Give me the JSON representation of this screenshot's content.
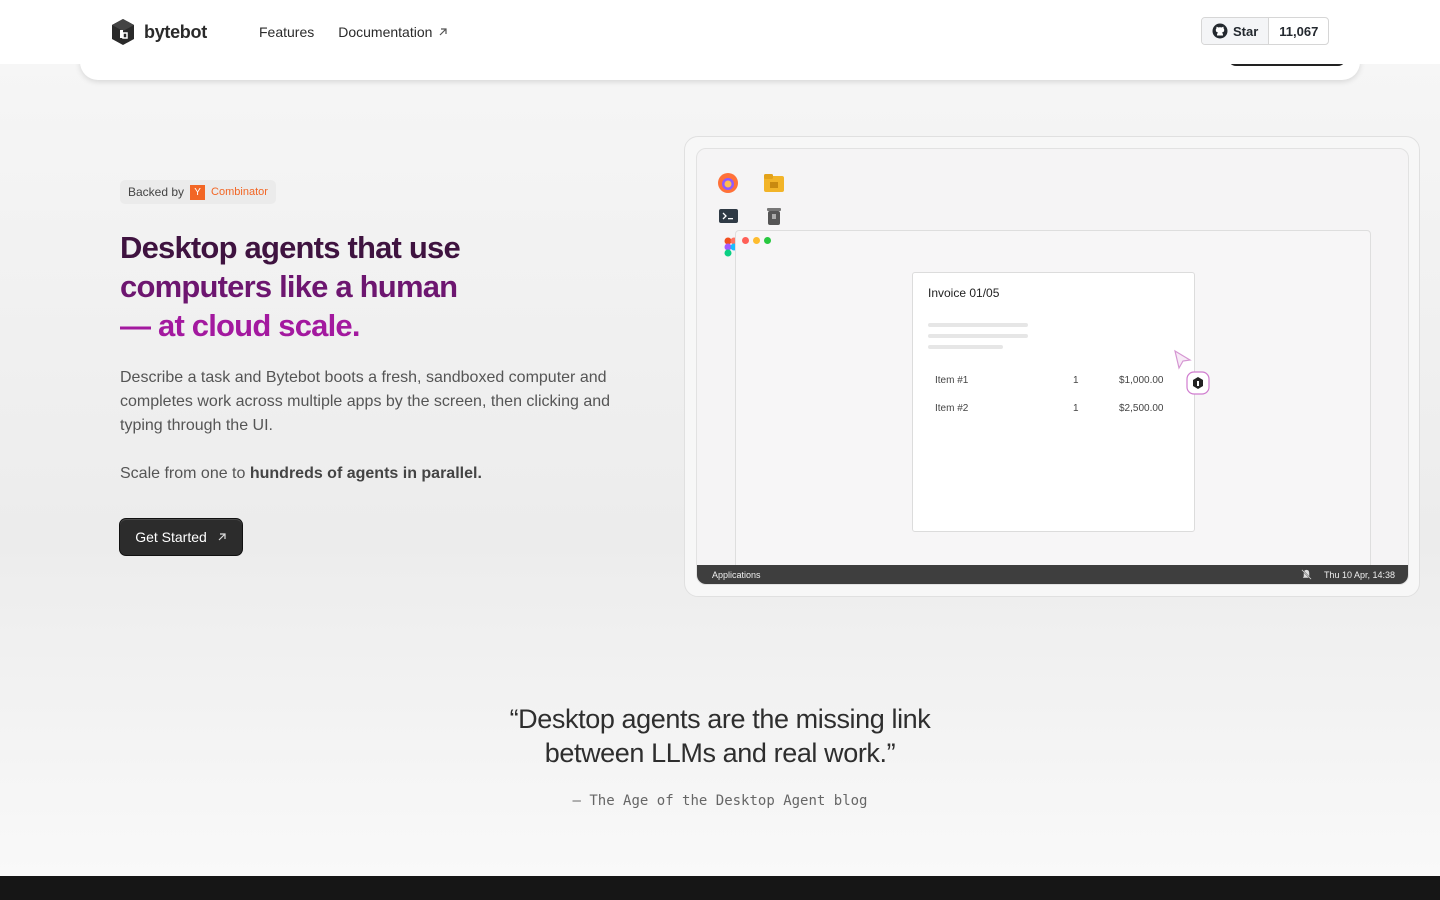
{
  "nav": {
    "brand": "bytebot",
    "links": [
      "Features",
      "Documentation"
    ],
    "github_star_label": "Star",
    "github_star_count": "11,067"
  },
  "hero": {
    "badge_prefix": "Backed by",
    "badge_yc_letter": "Y",
    "badge_yc_name": "Combinator",
    "headline_line1": "Desktop agents that use",
    "headline_line2": "computers like a human",
    "headline_line3": "— at cloud scale.",
    "description": "Describe a task and Bytebot boots a fresh, sandboxed computer and completes work across multiple apps by the screen, then clicking and typing through the UI.",
    "scale_prefix": "Scale from one to ",
    "scale_bold": "hundreds of agents in parallel.",
    "cta_label": "Get Started"
  },
  "desktop": {
    "invoice_title": "Invoice 01/05",
    "items": [
      {
        "name": "Item #1",
        "qty": "1",
        "price": "$1,000.00"
      },
      {
        "name": "Item #2",
        "qty": "1",
        "price": "$2,500.00"
      }
    ],
    "taskbar_left": "Applications",
    "taskbar_clock": "Thu 10 Apr, 14:38"
  },
  "quote": {
    "line1": "“Desktop agents are the missing link",
    "line2": "between LLMs and real work.”",
    "source": "— The Age of the Desktop Agent blog"
  }
}
